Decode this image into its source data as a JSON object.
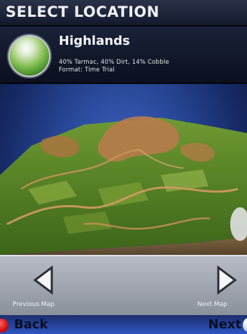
{
  "header": {
    "title": "SELECT LOCATION"
  },
  "location": {
    "name": "Highlands",
    "surfaces": "40% Tarmac, 40% Dirt, 14% Cobble",
    "format": "Format: Time Trial"
  },
  "nav": {
    "previous_label": "Previous Map",
    "next_label": "Next Map"
  },
  "footer": {
    "back_label": "Back",
    "next_label": "Next"
  },
  "colors": {
    "terrain": "#5f8a28",
    "track": "#c78b55",
    "accent_red": "#d41010"
  },
  "icons": [
    "location-badge-icon",
    "triangle-left-icon",
    "triangle-right-icon",
    "back-button-icon",
    "next-button-icon"
  ]
}
